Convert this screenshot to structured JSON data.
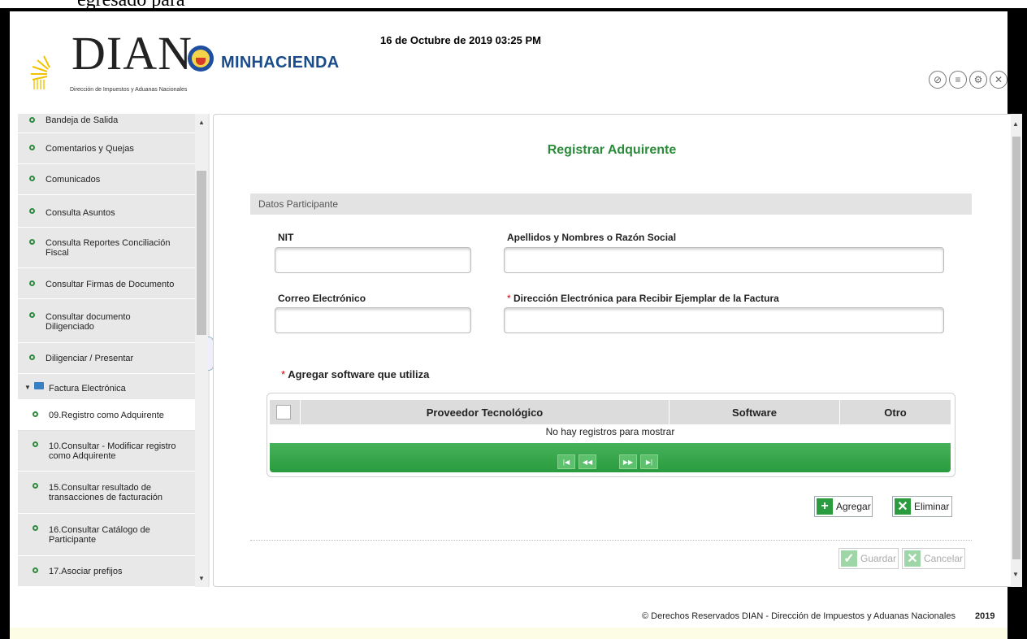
{
  "top_strip_text": "egresado para",
  "header": {
    "logo_text": "DIAN",
    "logo_subtitle": "Dirección de Impuestos y Aduanas Nacionales",
    "ministry": "MINHACIENDA",
    "datetime": "16 de Octubre de 2019 03:25 PM",
    "icons": [
      "pin-icon",
      "list-icon",
      "settings-icon",
      "close-icon"
    ]
  },
  "sidebar": {
    "items": [
      {
        "label": "Bandeja de Salida"
      },
      {
        "label": "Comentarios y Quejas"
      },
      {
        "label": "Comunicados"
      },
      {
        "label": "Consulta Asuntos"
      },
      {
        "label": "Consulta Reportes Conciliación Fiscal"
      },
      {
        "label": "Consultar Firmas de Documento"
      },
      {
        "label": "Consultar documento Diligenciado"
      },
      {
        "label": "Diligenciar / Presentar"
      }
    ],
    "folder": {
      "label": "Factura Electrónica"
    },
    "sub_items": [
      {
        "label": "09.Registro como Adquirente"
      },
      {
        "label": "10.Consultar - Modificar registro como Adquirente"
      },
      {
        "label": "15.Consultar resultado de transacciones de facturación"
      },
      {
        "label": "16.Consultar Catálogo de Participante"
      },
      {
        "label": "17.Asociar prefijos"
      }
    ]
  },
  "main": {
    "title": "Registrar Adquirente",
    "section": "Datos Participante",
    "fields": {
      "nit": {
        "label": "NIT",
        "value": ""
      },
      "nombre": {
        "label": "Apellidos y Nombres o Razón Social",
        "value": ""
      },
      "correo": {
        "label": "Correo Electrónico",
        "value": ""
      },
      "direccion": {
        "label": "Dirección Electrónica para Recibir Ejemplar de la Factura",
        "required": "*",
        "value": ""
      }
    },
    "software": {
      "required": "*",
      "label": "Agregar software que utiliza",
      "columns": [
        "Proveedor Tecnológico",
        "Software",
        "Otro"
      ],
      "empty_message": "No hay registros para mostrar"
    },
    "buttons": {
      "agregar": "Agregar",
      "eliminar": "Eliminar",
      "guardar": "Guardar",
      "cancelar": "Cancelar"
    }
  },
  "footer": {
    "copyright": "© Derechos Reservados DIAN - Dirección de Impuestos y Aduanas Nacionales",
    "year": "2019"
  },
  "colors": {
    "accent_green": "#2a8a3a",
    "ministry_blue": "#1a4c8b",
    "required_red": "#d40000"
  }
}
